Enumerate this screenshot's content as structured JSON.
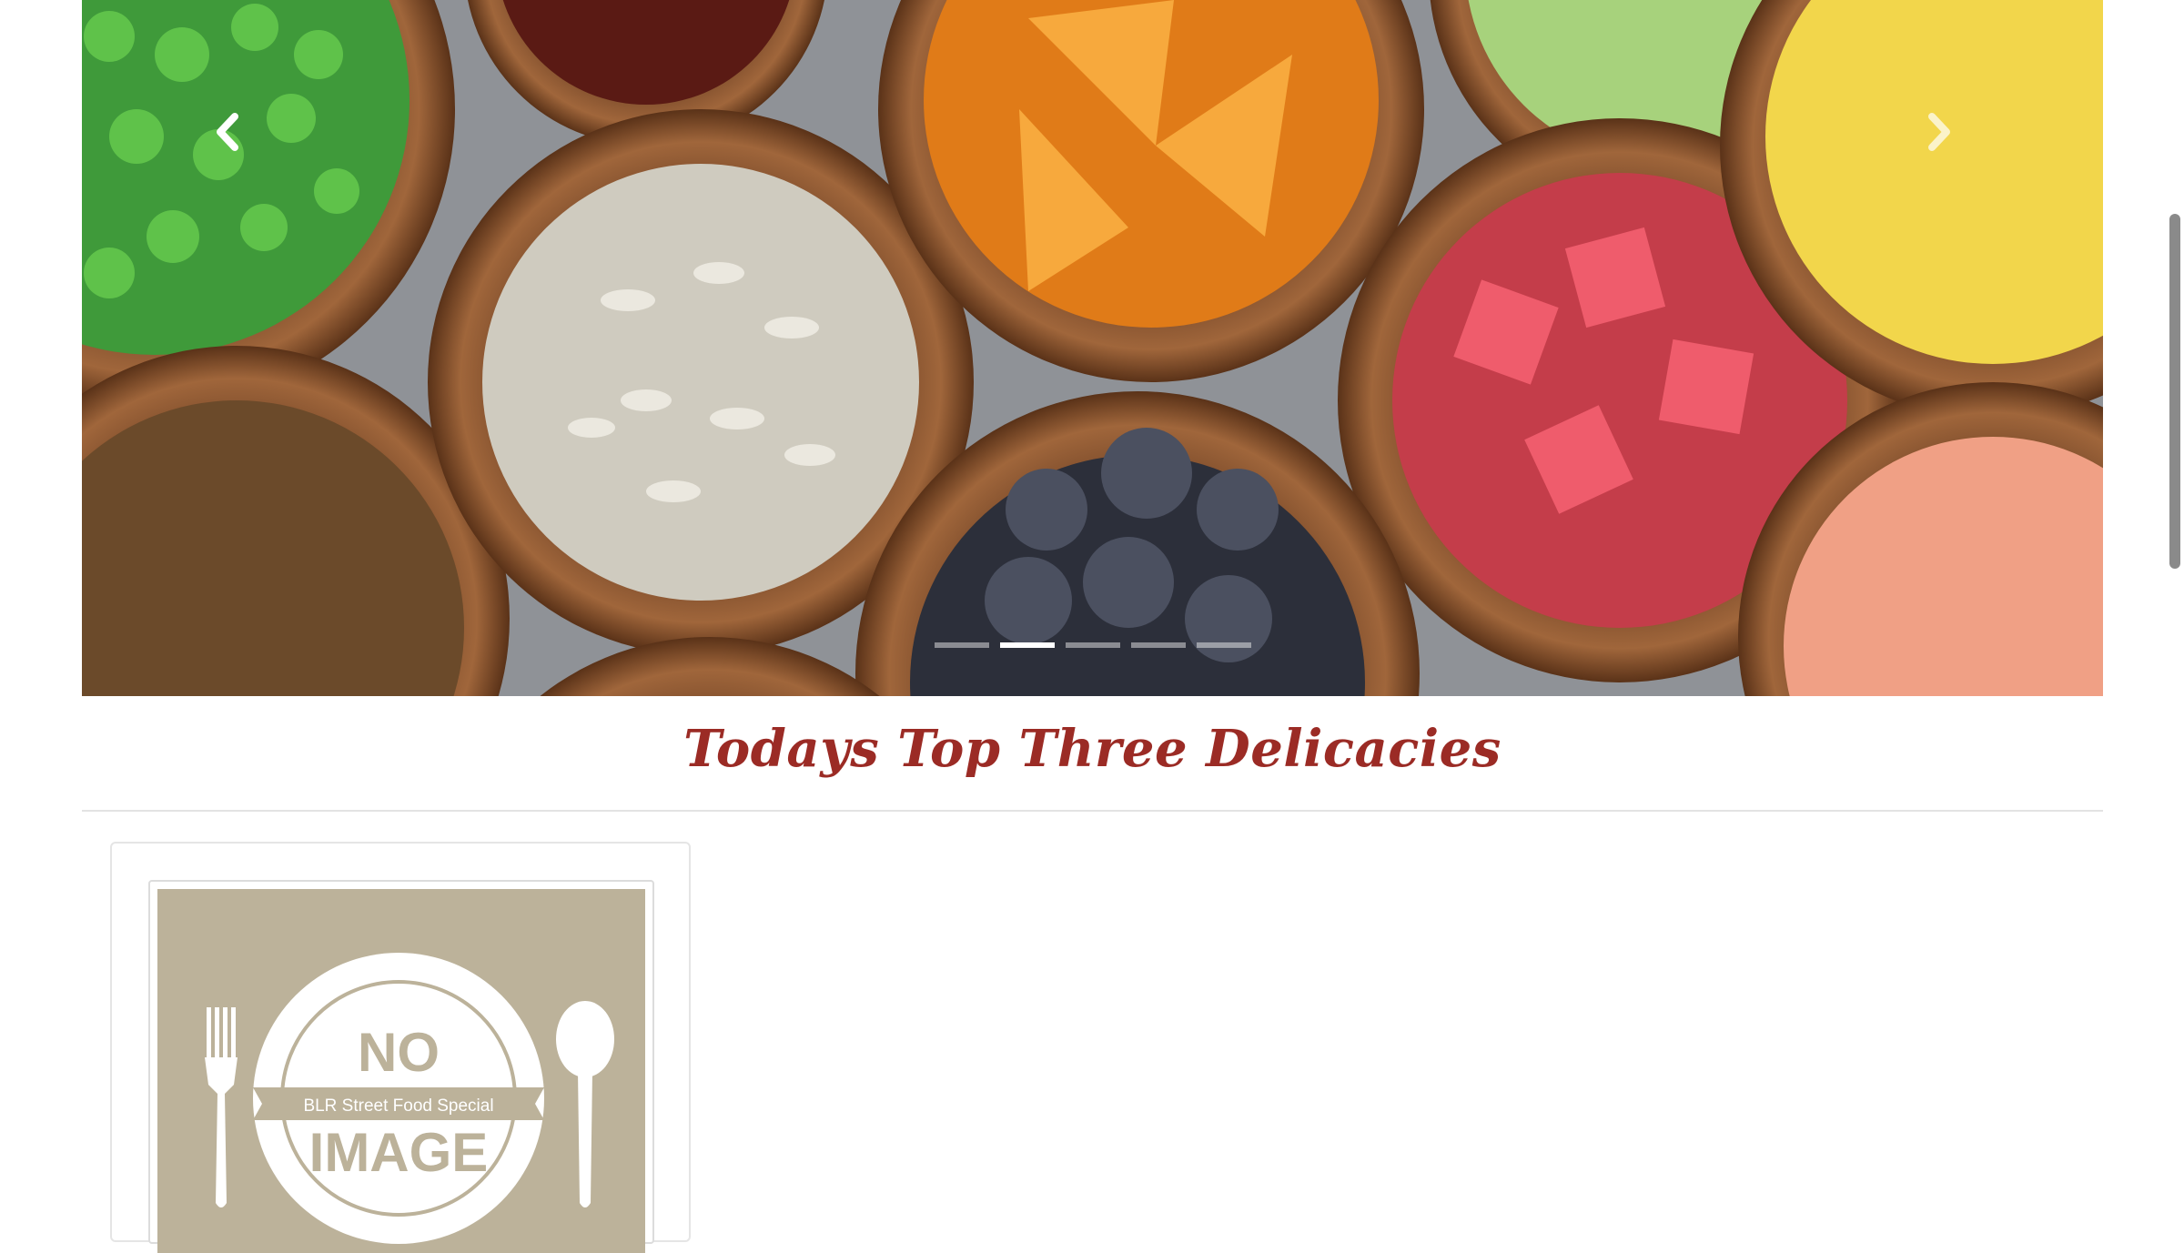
{
  "carousel": {
    "prev_icon": "chevron-left-icon",
    "next_icon": "chevron-right-icon",
    "slide_count": 5,
    "active_index": 1
  },
  "section": {
    "title": "Todays Top Three Delicacies"
  },
  "card": {
    "placeholder_line1": "NO",
    "placeholder_line2": "IMAGE",
    "placeholder_ribbon": "BLR Street Food Special"
  },
  "colors": {
    "title": "#9b2b25",
    "placeholder_bg": "#bcb29a"
  }
}
